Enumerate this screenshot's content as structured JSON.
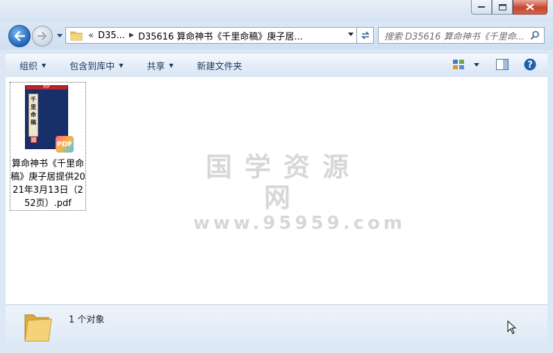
{
  "window": {
    "min_glyph": "━",
    "max_glyph": "□",
    "close_glyph": "✕"
  },
  "address": {
    "crumb_overflow": "«",
    "crumbs": [
      "D35...",
      "D35616 算命神书《千里命稿》庚子居..."
    ]
  },
  "search": {
    "placeholder": "搜索 D35616 算命神书《千里命..."
  },
  "toolbar": {
    "organize": "组织",
    "include_library": "包含到库中",
    "share": "共享",
    "new_folder": "新建文件夹"
  },
  "file": {
    "name": "算命神书《千里命稿》庚子居提供2021年3月13日（252页）.pdf",
    "thumb_top_label": "PDF",
    "thumb_title": "千里命稿",
    "badge": "PDF"
  },
  "watermark": {
    "line1": "国学资源网",
    "line2": "www.95959.com"
  },
  "status": {
    "text": "1 个对象"
  },
  "colors": {
    "accent": "#1e395b",
    "close_red": "#c8452e",
    "book_cover": "#17306a"
  }
}
